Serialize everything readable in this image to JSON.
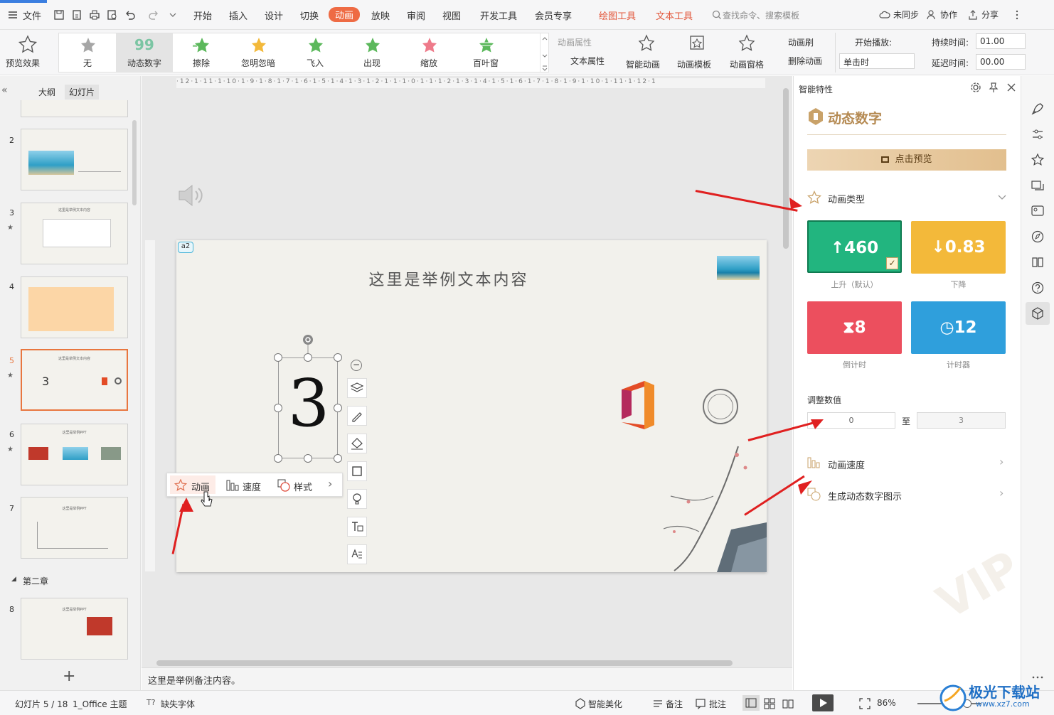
{
  "topbar": {
    "file": "文件",
    "tabs": [
      "开始",
      "插入",
      "设计",
      "切换",
      "动画",
      "放映",
      "审阅",
      "视图",
      "开发工具",
      "会员专享"
    ],
    "active_tab": "动画",
    "context_tabs": [
      "绘图工具",
      "文本工具"
    ],
    "search_placeholder": "查找命令、搜索模板",
    "sync": "未同步",
    "collab": "协作",
    "share": "分享"
  },
  "ribbon": {
    "preview": "预览效果",
    "gallery": [
      "无",
      "动态数字",
      "擦除",
      "忽明忽暗",
      "飞入",
      "出现",
      "缩放",
      "百叶窗"
    ],
    "anim_props": "动画属性",
    "text_props": "文本属性",
    "smart_anim": "智能动画",
    "anim_template": "动画模板",
    "anim_pane": "动画窗格",
    "anim_brush": "动画刷",
    "delete_anim": "删除动画",
    "start_play": "开始播放:",
    "start_value": "单击时",
    "duration_label": "持续时间:",
    "duration_value": "01.00",
    "delay_label": "延迟时间:",
    "delay_value": "00.00"
  },
  "leftpanel": {
    "tab_outline": "大纲",
    "tab_slides": "幻灯片",
    "slides": [
      {
        "num": "2",
        "title": ""
      },
      {
        "num": "3",
        "title": "这里是举例文本内容"
      },
      {
        "num": "4",
        "title": ""
      },
      {
        "num": "5",
        "title": "这里是举例文本内容",
        "big": "3"
      },
      {
        "num": "6",
        "title": "这里是举例PPT"
      },
      {
        "num": "7",
        "title": "这里是举例PPT"
      },
      {
        "num": "8",
        "title": "这里是举例PPT"
      }
    ],
    "section": "第二章"
  },
  "slide": {
    "tag": "a2",
    "title": "这里是举例文本内容",
    "number": "3"
  },
  "floatbar": {
    "anim": "动画",
    "speed": "速度",
    "style": "样式"
  },
  "notes": "这里是举例备注内容。",
  "rightpanel": {
    "header": "智能特性",
    "title": "动态数字",
    "preview_btn": "点击预览",
    "anim_type": "动画类型",
    "cards": [
      {
        "value": "460",
        "label": "上升（默认）",
        "color": "#22b57f"
      },
      {
        "value": "0.83",
        "label": "下降",
        "color": "#f3b93a"
      },
      {
        "value": "8",
        "label": "倒计时",
        "color": "#ec4f5e"
      },
      {
        "value": "12",
        "label": "计时器",
        "color": "#2f9fdc"
      }
    ],
    "adjust_label": "调整数值",
    "from_value": "0",
    "to_label": "至",
    "to_value": "3",
    "speed": "动画速度",
    "generate": "生成动态数字图示"
  },
  "statusbar": {
    "slide_info": "幻灯片 5 / 18",
    "theme": "1_Office 主题",
    "missing_font": "缺失字体",
    "beautify": "智能美化",
    "notes": "备注",
    "comment": "批注",
    "zoom": "86%"
  },
  "watermark": {
    "text": "极光下载站",
    "url": "www.xz7.com"
  }
}
